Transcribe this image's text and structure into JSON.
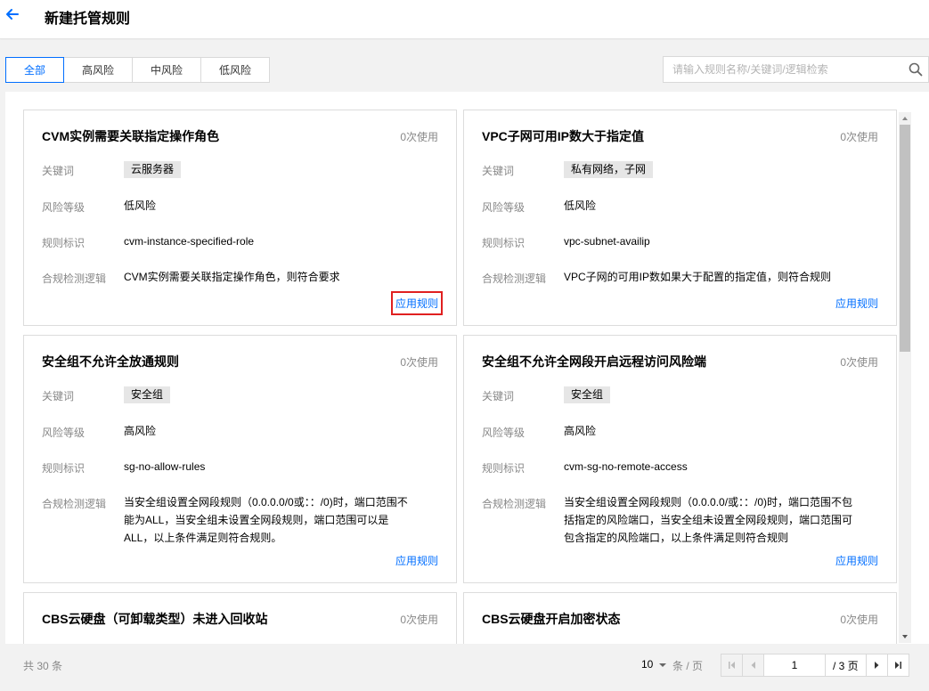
{
  "header": {
    "title": "新建托管规则"
  },
  "tabs": [
    {
      "label": "全部",
      "active": true
    },
    {
      "label": "高风险"
    },
    {
      "label": "中风险"
    },
    {
      "label": "低风险"
    }
  ],
  "search": {
    "placeholder": "请输入规则名称/关键词/逻辑检索"
  },
  "labels": {
    "keyword": "关键词",
    "risk": "风险等级",
    "id": "规则标识",
    "logic": "合规检测逻辑"
  },
  "cards": [
    {
      "title": "CVM实例需要关联指定操作角色",
      "usage": "0次使用",
      "keyword": "云服务器",
      "risk": "低风险",
      "id": "cvm-instance-specified-role",
      "logic": "CVM实例需要关联指定操作角色，则符合要求",
      "apply": "应用规则"
    },
    {
      "title": "VPC子网可用IP数大于指定值",
      "usage": "0次使用",
      "keyword": "私有网络，子网",
      "risk": "低风险",
      "id": "vpc-subnet-availip",
      "logic": "VPC子网的可用IP数如果大于配置的指定值，则符合规则",
      "apply": "应用规则"
    },
    {
      "title": "安全组不允许全放通规则",
      "usage": "0次使用",
      "keyword": "安全组",
      "risk": "高风险",
      "id": "sg-no-allow-rules",
      "logic": "当安全组设置全网段规则（0.0.0.0/0或：：/0)时，端口范围不能为ALL，当安全组未设置全网段规则，端口范围可以是ALL，以上条件满足则符合规则。",
      "apply": "应用规则"
    },
    {
      "title": "安全组不允许全网段开启远程访问风险端",
      "usage": "0次使用",
      "keyword": "安全组",
      "risk": "高风险",
      "id": "cvm-sg-no-remote-access",
      "logic": "当安全组设置全网段规则（0.0.0.0/或：：/0)时，端口范围不包括指定的风险端口，当安全组未设置全网段规则，端口范围可包含指定的风险端口，以上条件满足则符合规则",
      "apply": "应用规则"
    },
    {
      "title": "CBS云硬盘（可卸载类型）未进入回收站",
      "usage": "0次使用"
    },
    {
      "title": "CBS云硬盘开启加密状态",
      "usage": "0次使用"
    }
  ],
  "pagination": {
    "total": "共 30 条",
    "page_size": "10",
    "page_size_unit": "条 / 页",
    "current_page": "1",
    "total_pages": "/ 3 页"
  },
  "colors": {
    "accent": "#006eff",
    "highlight": "#e02020"
  }
}
